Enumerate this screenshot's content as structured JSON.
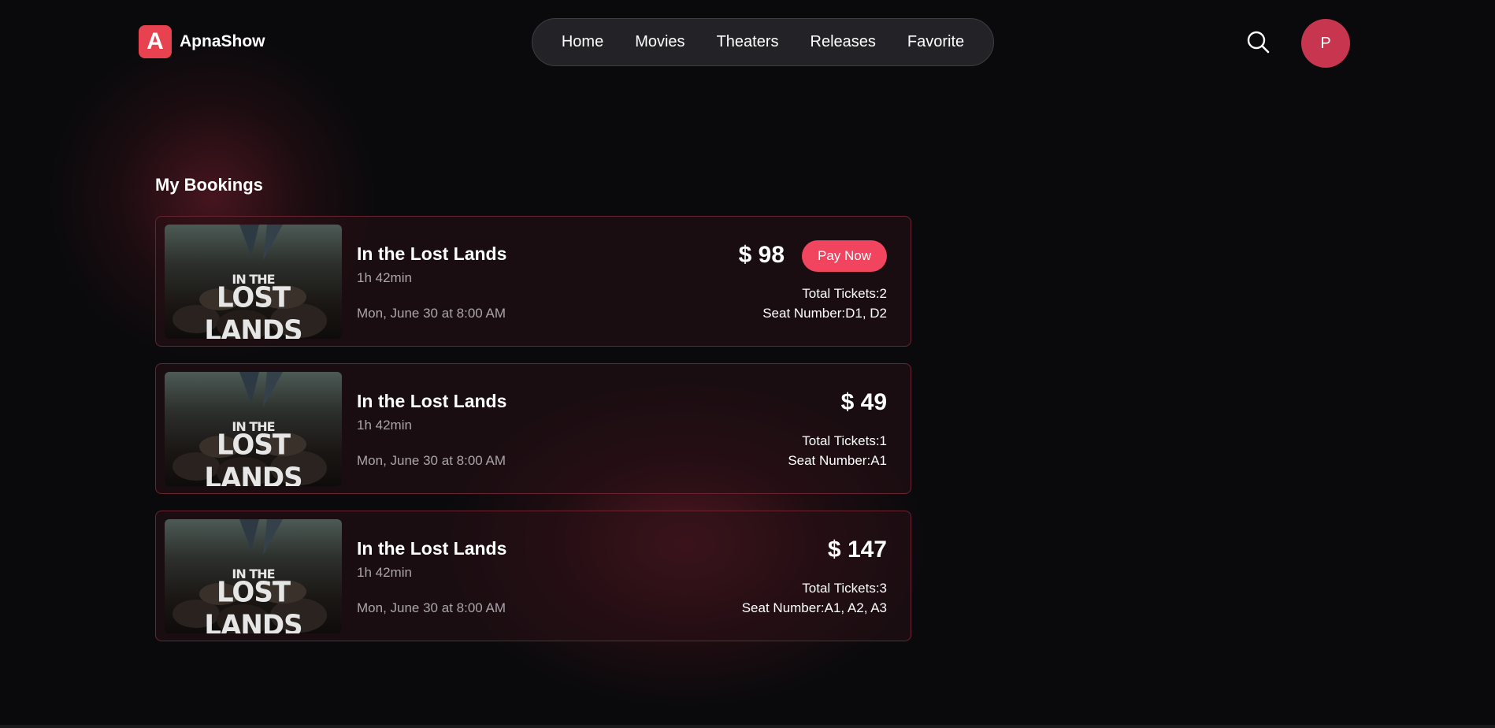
{
  "brand": {
    "logo_letter": "A",
    "name": "ApnaShow",
    "accent": "#e8414f"
  },
  "nav": [
    "Home",
    "Movies",
    "Theaters",
    "Releases",
    "Favorite"
  ],
  "header": {
    "search_icon": "search-icon",
    "avatar_initial": "P",
    "avatar_color": "#c8354f"
  },
  "page_title": "My Bookings",
  "bookings": [
    {
      "poster_small": "IN THE",
      "poster_large": "LOST LANDS",
      "title": "In the Lost Lands",
      "duration": "1h 42min",
      "showtime": "Mon, June 30 at 8:00 AM",
      "price": "$ 98",
      "pay_label": "Pay Now",
      "tickets": "Total Tickets:2",
      "seats": "Seat Number:D1, D2"
    },
    {
      "poster_small": "IN THE",
      "poster_large": "LOST LANDS",
      "title": "In the Lost Lands",
      "duration": "1h 42min",
      "showtime": "Mon, June 30 at 8:00 AM",
      "price": "$ 49",
      "tickets": "Total Tickets:1",
      "seats": "Seat Number:A1"
    },
    {
      "poster_small": "IN THE",
      "poster_large": "LOST LANDS",
      "title": "In the Lost Lands",
      "duration": "1h 42min",
      "showtime": "Mon, June 30 at 8:00 AM",
      "price": "$ 147",
      "tickets": "Total Tickets:3",
      "seats": "Seat Number:A1, A2, A3"
    }
  ],
  "colors": {
    "pay_button": "#f0445f",
    "card_border": "#6a2430",
    "muted_text": "#a9a6aa"
  }
}
